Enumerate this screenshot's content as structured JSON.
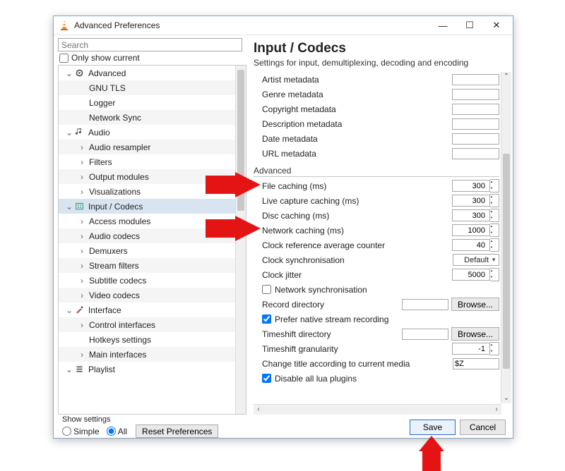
{
  "window": {
    "title": "Advanced Preferences"
  },
  "sidebar": {
    "search_placeholder": "Search",
    "only_show": "Only show current",
    "items": [
      {
        "label": "Advanced",
        "depth": 0,
        "exp": "v",
        "icon": "gear"
      },
      {
        "label": "GNU TLS",
        "depth": 1
      },
      {
        "label": "Logger",
        "depth": 1
      },
      {
        "label": "Network Sync",
        "depth": 1
      },
      {
        "label": "Audio",
        "depth": 0,
        "exp": "v",
        "icon": "note"
      },
      {
        "label": "Audio resampler",
        "depth": 1,
        "exp": ">"
      },
      {
        "label": "Filters",
        "depth": 1,
        "exp": ">"
      },
      {
        "label": "Output modules",
        "depth": 1,
        "exp": ">"
      },
      {
        "label": "Visualizations",
        "depth": 1,
        "exp": ">"
      },
      {
        "label": "Input / Codecs",
        "depth": 0,
        "exp": "v",
        "icon": "codec",
        "selected": true
      },
      {
        "label": "Access modules",
        "depth": 1,
        "exp": ">"
      },
      {
        "label": "Audio codecs",
        "depth": 1,
        "exp": ">"
      },
      {
        "label": "Demuxers",
        "depth": 1,
        "exp": ">"
      },
      {
        "label": "Stream filters",
        "depth": 1,
        "exp": ">"
      },
      {
        "label": "Subtitle codecs",
        "depth": 1,
        "exp": ">"
      },
      {
        "label": "Video codecs",
        "depth": 1,
        "exp": ">"
      },
      {
        "label": "Interface",
        "depth": 0,
        "exp": "v",
        "icon": "brush"
      },
      {
        "label": "Control interfaces",
        "depth": 1,
        "exp": ">"
      },
      {
        "label": "Hotkeys settings",
        "depth": 1
      },
      {
        "label": "Main interfaces",
        "depth": 1,
        "exp": ">"
      },
      {
        "label": "Playlist",
        "depth": 0,
        "exp": "v",
        "icon": "list"
      }
    ]
  },
  "main": {
    "title": "Input / Codecs",
    "desc": "Settings for input, demultiplexing, decoding and encoding",
    "meta": [
      {
        "label": "Artist metadata"
      },
      {
        "label": "Genre metadata"
      },
      {
        "label": "Copyright metadata"
      },
      {
        "label": "Description metadata"
      },
      {
        "label": "Date metadata"
      },
      {
        "label": "URL metadata"
      }
    ],
    "advanced_header": "Advanced",
    "advanced": [
      {
        "label": "File caching (ms)",
        "type": "num",
        "value": "300"
      },
      {
        "label": "Live capture caching (ms)",
        "type": "num",
        "value": "300"
      },
      {
        "label": "Disc caching (ms)",
        "type": "num",
        "value": "300"
      },
      {
        "label": "Network caching (ms)",
        "type": "num",
        "value": "1000"
      },
      {
        "label": "Clock reference average counter",
        "type": "num",
        "value": "40"
      },
      {
        "label": "Clock synchronisation",
        "type": "sel",
        "value": "Default"
      },
      {
        "label": "Clock jitter",
        "type": "num",
        "value": "5000"
      },
      {
        "label": "Network synchronisation",
        "type": "chk",
        "checked": false
      },
      {
        "label": "Record directory",
        "type": "browse",
        "value": ""
      },
      {
        "label": "Prefer native stream recording",
        "type": "chk",
        "checked": true
      },
      {
        "label": "Timeshift directory",
        "type": "browse",
        "value": ""
      },
      {
        "label": "Timeshift granularity",
        "type": "num",
        "value": "-1"
      },
      {
        "label": "Change title according to current media",
        "type": "txt",
        "value": "$Z"
      },
      {
        "label": "Disable all lua plugins",
        "type": "chk",
        "checked": true
      }
    ],
    "browse_label": "Browse..."
  },
  "footer": {
    "show_settings": "Show settings",
    "simple": "Simple",
    "all": "All",
    "reset": "Reset Preferences",
    "save": "Save",
    "cancel": "Cancel"
  }
}
